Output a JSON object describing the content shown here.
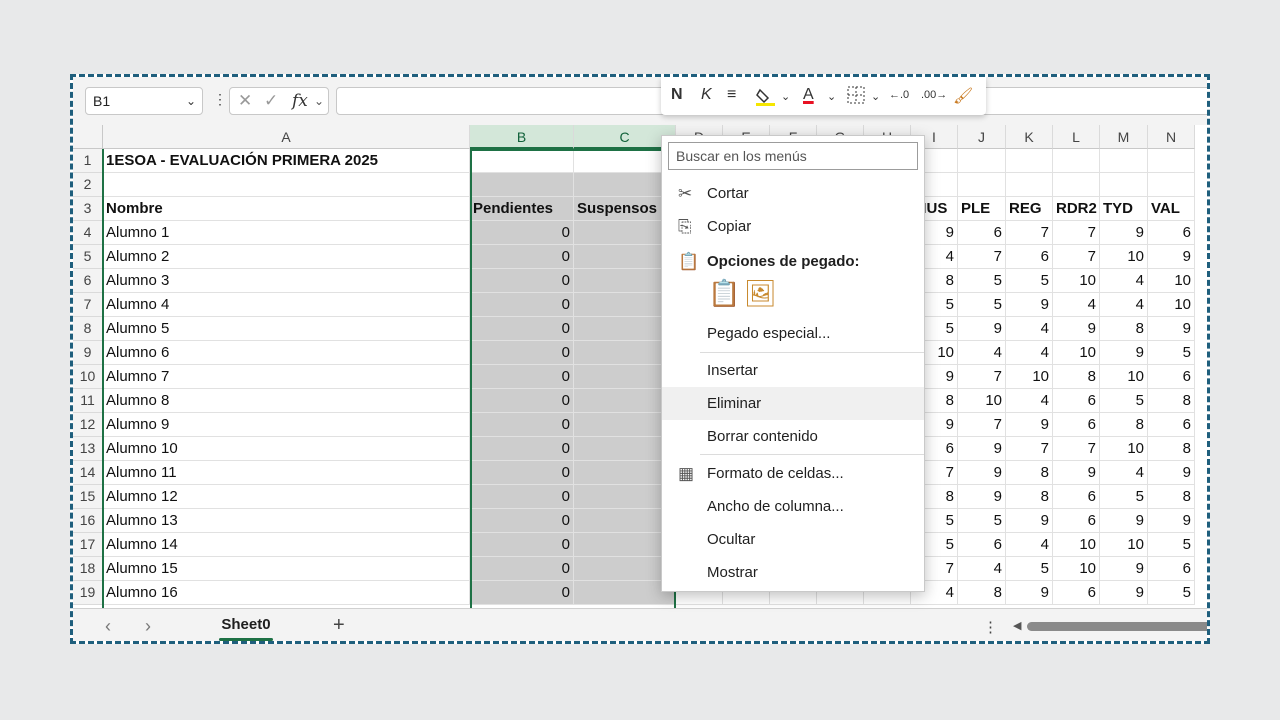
{
  "formula_bar": {
    "name_box": "B1",
    "cancel_glyph": "✕",
    "enter_glyph": "✓",
    "fx_glyph": "fx",
    "formula_value": ""
  },
  "mini_toolbar": {
    "bold": "N",
    "italic": "K",
    "align": "≡",
    "fill_icon": "fill-color-icon",
    "font_color": "A",
    "borders_icon": "borders-icon",
    "decrease_decimal": "←.0",
    "increase_decimal": ".00→",
    "format_painter_icon": "format-painter-icon"
  },
  "columns": [
    "A",
    "B",
    "C",
    "D",
    "E",
    "F",
    "G",
    "H",
    "I",
    "J",
    "K",
    "L",
    "M",
    "N"
  ],
  "rows": [
    "1",
    "2",
    "3",
    "4",
    "5",
    "6",
    "7",
    "8",
    "9",
    "10",
    "11",
    "12",
    "13",
    "14",
    "15",
    "16",
    "17",
    "18",
    "19"
  ],
  "sheet": {
    "a1_title": "1ESOA - EVALUACIÓN PRIMERA 2025",
    "header_a": "Nombre",
    "header_b": "Pendientes",
    "header_c": "Suspensos",
    "headers_right": [
      "MUS",
      "PLE",
      "REG",
      "RDR2",
      "TYD",
      "VAL"
    ],
    "students": [
      {
        "name": "Alumno 1",
        "b": "0",
        "r": [
          "9",
          "6",
          "7",
          "7",
          "9",
          "6"
        ]
      },
      {
        "name": "Alumno 2",
        "b": "0",
        "r": [
          "4",
          "7",
          "6",
          "7",
          "10",
          "9"
        ]
      },
      {
        "name": "Alumno 3",
        "b": "0",
        "r": [
          "8",
          "5",
          "5",
          "10",
          "4",
          "10"
        ]
      },
      {
        "name": "Alumno 4",
        "b": "0",
        "r": [
          "5",
          "5",
          "9",
          "4",
          "4",
          "10"
        ]
      },
      {
        "name": "Alumno 5",
        "b": "0",
        "r": [
          "5",
          "9",
          "4",
          "9",
          "8",
          "9"
        ]
      },
      {
        "name": "Alumno 6",
        "b": "0",
        "r": [
          "10",
          "4",
          "4",
          "10",
          "9",
          "5"
        ]
      },
      {
        "name": "Alumno 7",
        "b": "0",
        "r": [
          "9",
          "7",
          "10",
          "8",
          "10",
          "6"
        ]
      },
      {
        "name": "Alumno 8",
        "b": "0",
        "r": [
          "8",
          "10",
          "4",
          "6",
          "5",
          "8"
        ]
      },
      {
        "name": "Alumno 9",
        "b": "0",
        "r": [
          "9",
          "7",
          "9",
          "6",
          "8",
          "6"
        ]
      },
      {
        "name": "Alumno 10",
        "b": "0",
        "r": [
          "6",
          "9",
          "7",
          "7",
          "10",
          "8"
        ]
      },
      {
        "name": "Alumno 11",
        "b": "0",
        "r": [
          "7",
          "9",
          "8",
          "9",
          "4",
          "9"
        ]
      },
      {
        "name": "Alumno 12",
        "b": "0",
        "r": [
          "8",
          "9",
          "8",
          "6",
          "5",
          "8"
        ]
      },
      {
        "name": "Alumno 13",
        "b": "0",
        "r": [
          "5",
          "5",
          "9",
          "6",
          "9",
          "9"
        ]
      },
      {
        "name": "Alumno 14",
        "b": "0",
        "r": [
          "5",
          "6",
          "4",
          "10",
          "10",
          "5"
        ]
      },
      {
        "name": "Alumno 15",
        "b": "0",
        "r": [
          "7",
          "4",
          "5",
          "10",
          "9",
          "6"
        ]
      },
      {
        "name": "Alumno 16",
        "b": "0",
        "r": [
          "4",
          "8",
          "9",
          "6",
          "9",
          "5"
        ]
      }
    ]
  },
  "context_menu": {
    "search_placeholder": "Buscar en los menús",
    "cut": "Cortar",
    "copy": "Copiar",
    "paste_options": "Opciones de pegado:",
    "paste_special": "Pegado especial...",
    "insert": "Insertar",
    "delete": "Eliminar",
    "clear_contents": "Borrar contenido",
    "format_cells": "Formato de celdas...",
    "column_width": "Ancho de columna...",
    "hide": "Ocultar",
    "unhide": "Mostrar"
  },
  "tabs": {
    "active_sheet": "Sheet0",
    "add_sheet": "+"
  }
}
